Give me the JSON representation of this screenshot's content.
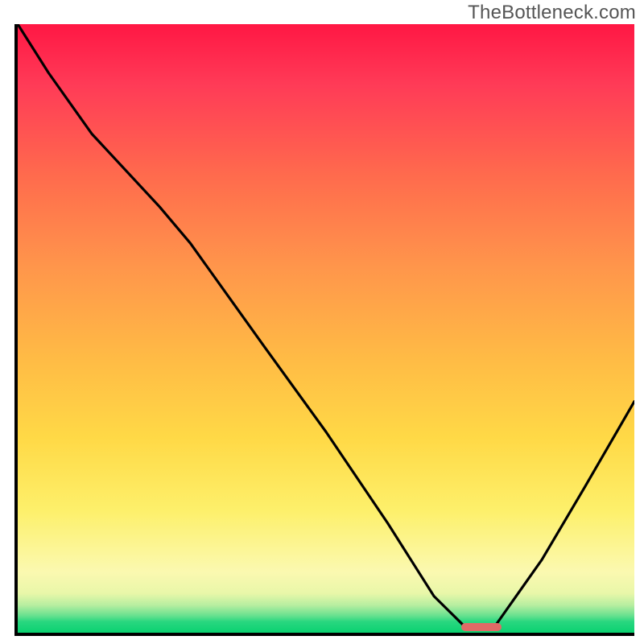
{
  "watermark": {
    "text": "TheBottleneck.com"
  },
  "chart_data": {
    "type": "line",
    "title": "",
    "xlabel": "",
    "ylabel": "",
    "xlim": [
      0,
      100
    ],
    "ylim": [
      0,
      100
    ],
    "x": [
      0,
      5,
      12,
      23,
      28,
      40,
      50,
      60,
      67.5,
      73,
      77,
      85,
      92,
      100
    ],
    "values": [
      100,
      92,
      82,
      70,
      64,
      47,
      33,
      18,
      6,
      0.5,
      0.5,
      12,
      24,
      38
    ],
    "highlight_range_x": [
      71.5,
      78
    ],
    "gradient": {
      "top": "#ff1744",
      "mid_orange": "#ff964b",
      "yellow": "#ffd946",
      "pale": "#fbf9b0",
      "green": "#0bd171"
    },
    "highlight_color": "#e06a66",
    "curve_color": "#000000"
  }
}
